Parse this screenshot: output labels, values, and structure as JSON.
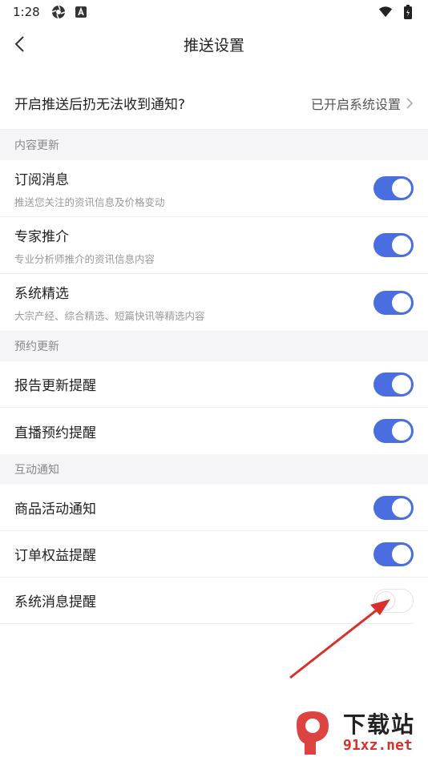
{
  "status_bar": {
    "time": "1:28"
  },
  "header": {
    "title": "推送设置"
  },
  "notice": {
    "question": "开启推送后扔无法收到通知?",
    "status": "已开启系统设置"
  },
  "sections": [
    {
      "title": "内容更新",
      "items": [
        {
          "label": "订阅消息",
          "sub": "推送您关注的资讯信息及价格变动",
          "on": true
        },
        {
          "label": "专家推介",
          "sub": "专业分析师推介的资讯信息内容",
          "on": true
        },
        {
          "label": "系统精选",
          "sub": "大宗产经、综合精选、短篇快讯等精选内容",
          "on": true
        }
      ]
    },
    {
      "title": "预约更新",
      "items": [
        {
          "label": "报告更新提醒",
          "on": true
        },
        {
          "label": "直播预约提醒",
          "on": true
        }
      ]
    },
    {
      "title": "互动通知",
      "items": [
        {
          "label": "商品活动通知",
          "on": true
        },
        {
          "label": "订单权益提醒",
          "on": true
        },
        {
          "label": "系统消息提醒",
          "on": false
        }
      ]
    }
  ],
  "watermark": {
    "title": "下载站",
    "url": "91xz.net",
    "badge": "9"
  },
  "colors": {
    "toggle_on": "#4a6ee0",
    "section_bg": "#f5f5f7",
    "arrow": "#d9302c"
  }
}
